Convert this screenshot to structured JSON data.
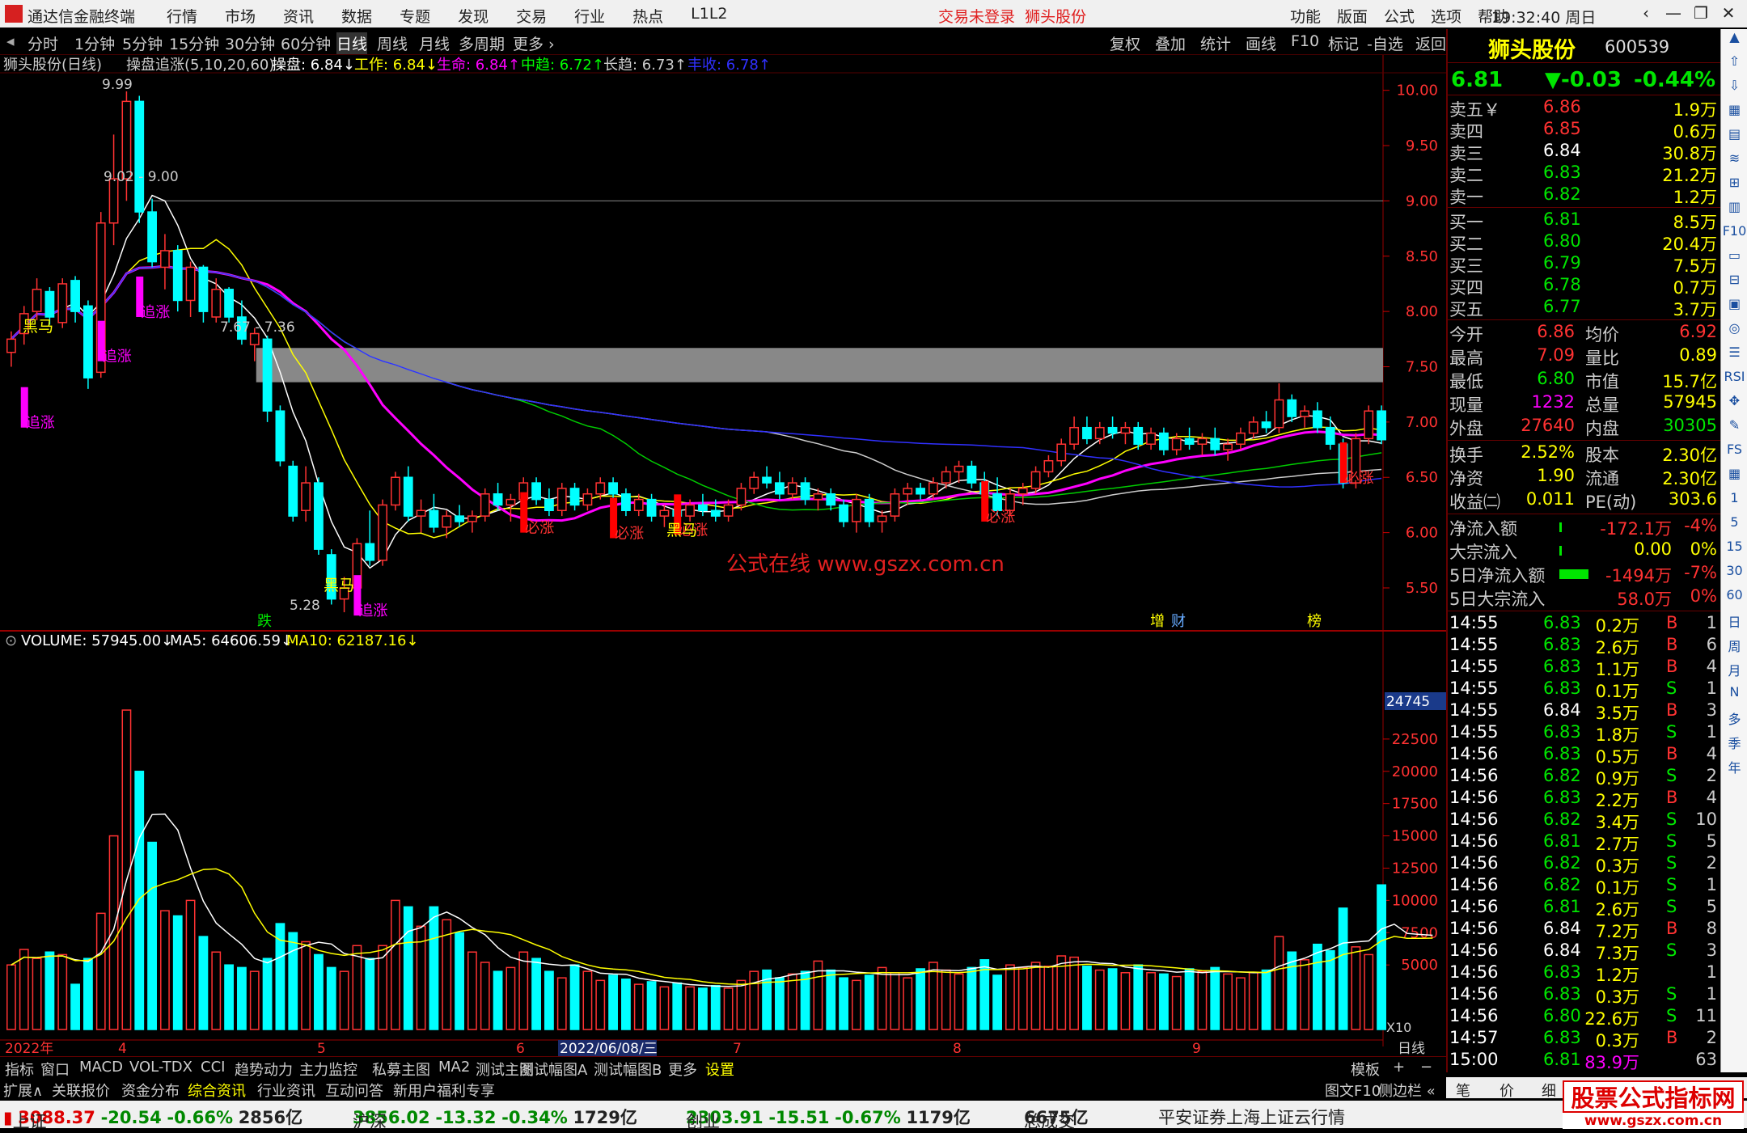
{
  "app": {
    "name": "通达信金融终端",
    "menu": [
      "行情",
      "市场",
      "资讯",
      "数据",
      "专题",
      "发现",
      "交易",
      "行业",
      "热点",
      "L1L2"
    ],
    "trade_status": "交易未登录",
    "stock_title": "狮头股份",
    "sysmenu": [
      "功能",
      "版面",
      "公式",
      "选项",
      "帮助"
    ],
    "time": "19:32:40",
    "weekday": "周日",
    "win_btns": [
      "‹",
      "—",
      "❐",
      "✕"
    ]
  },
  "periods": [
    "分时",
    "1分钟",
    "5分钟",
    "15分钟",
    "30分钟",
    "60分钟",
    "日线",
    "周线",
    "月线",
    "多周期",
    "更多 ›"
  ],
  "active_period": "日线",
  "ftools": [
    "复权",
    "叠加",
    "统计",
    "画线",
    "F10",
    "标记",
    "-自选",
    "返回"
  ],
  "main_chart": {
    "title": "狮头股份(日线)",
    "indicator": "操盘追涨(5,10,20,60)",
    "legend": [
      {
        "label": "操盘: 6.84",
        "arrow": "↓",
        "color": "#ffffff"
      },
      {
        "label": "工作: 6.84",
        "arrow": "↓",
        "color": "#ffff00"
      },
      {
        "label": "生命: 6.84",
        "arrow": "↑",
        "color": "#ff00ff"
      },
      {
        "label": "中趋: 6.72",
        "arrow": "↑",
        "color": "#00ff00"
      },
      {
        "label": "长趋: 6.73",
        "arrow": "↑",
        "color": "#cccccc"
      },
      {
        "label": "丰收: 6.78",
        "arrow": "↑",
        "color": "#3030ff"
      }
    ],
    "yaxis": [
      "10.00",
      "9.50",
      "9.00",
      "8.50",
      "8.00",
      "7.50",
      "7.00",
      "6.50",
      "6.00",
      "5.50"
    ],
    "annotations": {
      "high": "9.99",
      "range": "9.02 - 9.00",
      "band": "7.67 - 7.36",
      "low": "5.28",
      "heima": "黑马",
      "zhuizhang": "追涨",
      "bizhang": "必涨",
      "die": "跌",
      "zeng": "增",
      "cai": "财",
      "bang": "榜",
      "watermark": "公式在线  www.gszx.com.cn"
    }
  },
  "volume_chart": {
    "legend": [
      {
        "label": "VOLUME: 57945.00",
        "arrow": "↓",
        "color": "#ffffff"
      },
      {
        "label": "MA5: 64606.59",
        "arrow": "↓",
        "color": "#ffffff"
      },
      {
        "label": "MA10: 62187.16",
        "arrow": "↓",
        "color": "#ffff00"
      }
    ],
    "yaxis": [
      "22500",
      "20000",
      "17500",
      "15000",
      "12500",
      "10000",
      "7500",
      "5000"
    ],
    "ymax_label": "24745",
    "unit": "X10"
  },
  "time_axis": {
    "labels": [
      "2022年",
      "4",
      "5",
      "6",
      "2022/06/08/三",
      "7",
      "8",
      "9"
    ],
    "period": "日线"
  },
  "chart_data": {
    "type": "candlestick",
    "title": "狮头股份(日线)",
    "ylim": [
      5.2,
      10.1
    ],
    "ohlc": [
      [
        7.63,
        7.82,
        7.5,
        7.75
      ],
      [
        7.8,
        8.05,
        7.7,
        7.98
      ],
      [
        8.0,
        8.3,
        7.92,
        8.2
      ],
      [
        8.18,
        8.22,
        7.88,
        7.95
      ],
      [
        7.9,
        8.3,
        7.85,
        8.25
      ],
      [
        8.28,
        8.32,
        7.9,
        8.0
      ],
      [
        8.05,
        8.1,
        7.3,
        7.4
      ],
      [
        7.45,
        8.9,
        7.4,
        8.8
      ],
      [
        8.8,
        9.6,
        8.6,
        9.2
      ],
      [
        9.2,
        9.99,
        9.0,
        9.9
      ],
      [
        9.9,
        9.95,
        8.8,
        8.9
      ],
      [
        8.9,
        9.02,
        8.4,
        8.45
      ],
      [
        8.4,
        8.7,
        8.2,
        8.55
      ],
      [
        8.55,
        8.6,
        8.0,
        8.1
      ],
      [
        8.1,
        8.45,
        7.95,
        8.4
      ],
      [
        8.4,
        8.42,
        7.9,
        8.0
      ],
      [
        7.95,
        8.3,
        7.9,
        8.2
      ],
      [
        8.2,
        8.22,
        7.9,
        7.95
      ],
      [
        7.95,
        8.1,
        7.7,
        7.75
      ],
      [
        7.7,
        7.85,
        7.55,
        7.8
      ],
      [
        7.75,
        7.78,
        7.0,
        7.1
      ],
      [
        7.1,
        7.15,
        6.6,
        6.65
      ],
      [
        6.6,
        6.65,
        6.1,
        6.15
      ],
      [
        6.2,
        6.6,
        6.1,
        6.45
      ],
      [
        6.45,
        6.5,
        5.8,
        5.85
      ],
      [
        5.8,
        5.85,
        5.35,
        5.4
      ],
      [
        5.4,
        5.6,
        5.28,
        5.5
      ],
      [
        5.5,
        5.95,
        5.45,
        5.9
      ],
      [
        5.9,
        6.2,
        5.7,
        5.75
      ],
      [
        5.75,
        6.3,
        5.7,
        6.25
      ],
      [
        6.25,
        6.55,
        6.2,
        6.5
      ],
      [
        6.5,
        6.6,
        6.1,
        6.15
      ],
      [
        6.15,
        6.3,
        6.0,
        6.2
      ],
      [
        6.2,
        6.35,
        6.0,
        6.05
      ],
      [
        6.05,
        6.2,
        5.95,
        6.15
      ],
      [
        6.15,
        6.25,
        6.05,
        6.1
      ],
      [
        6.1,
        6.2,
        6.0,
        6.15
      ],
      [
        6.15,
        6.4,
        6.1,
        6.35
      ],
      [
        6.35,
        6.45,
        6.2,
        6.25
      ],
      [
        6.25,
        6.35,
        6.1,
        6.3
      ],
      [
        6.3,
        6.5,
        6.25,
        6.45
      ],
      [
        6.45,
        6.5,
        6.25,
        6.3
      ],
      [
        6.3,
        6.4,
        6.15,
        6.2
      ],
      [
        6.2,
        6.45,
        6.15,
        6.4
      ],
      [
        6.4,
        6.45,
        6.2,
        6.25
      ],
      [
        6.25,
        6.4,
        6.2,
        6.35
      ],
      [
        6.35,
        6.5,
        6.3,
        6.45
      ],
      [
        6.45,
        6.5,
        6.3,
        6.35
      ],
      [
        6.35,
        6.4,
        6.15,
        6.2
      ],
      [
        6.2,
        6.35,
        6.15,
        6.3
      ],
      [
        6.3,
        6.35,
        6.1,
        6.15
      ],
      [
        6.15,
        6.25,
        6.05,
        6.2
      ],
      [
        6.2,
        6.3,
        6.1,
        6.15
      ],
      [
        6.15,
        6.3,
        6.1,
        6.25
      ],
      [
        6.25,
        6.35,
        6.15,
        6.2
      ],
      [
        6.2,
        6.3,
        6.1,
        6.15
      ],
      [
        6.15,
        6.3,
        6.1,
        6.25
      ],
      [
        6.25,
        6.45,
        6.2,
        6.4
      ],
      [
        6.4,
        6.55,
        6.35,
        6.5
      ],
      [
        6.5,
        6.6,
        6.4,
        6.45
      ],
      [
        6.45,
        6.55,
        6.3,
        6.35
      ],
      [
        6.35,
        6.5,
        6.3,
        6.45
      ],
      [
        6.45,
        6.5,
        6.25,
        6.3
      ],
      [
        6.3,
        6.4,
        6.2,
        6.35
      ],
      [
        6.35,
        6.4,
        6.2,
        6.25
      ],
      [
        6.25,
        6.3,
        6.05,
        6.1
      ],
      [
        6.1,
        6.35,
        6.0,
        6.3
      ],
      [
        6.3,
        6.35,
        6.05,
        6.1
      ],
      [
        6.1,
        6.2,
        6.0,
        6.15
      ],
      [
        6.15,
        6.4,
        6.1,
        6.35
      ],
      [
        6.35,
        6.45,
        6.25,
        6.4
      ],
      [
        6.4,
        6.45,
        6.3,
        6.35
      ],
      [
        6.35,
        6.5,
        6.3,
        6.45
      ],
      [
        6.45,
        6.6,
        6.4,
        6.55
      ],
      [
        6.55,
        6.65,
        6.45,
        6.6
      ],
      [
        6.6,
        6.65,
        6.4,
        6.45
      ],
      [
        6.45,
        6.55,
        6.3,
        6.35
      ],
      [
        6.35,
        6.5,
        6.15,
        6.2
      ],
      [
        6.2,
        6.4,
        6.15,
        6.35
      ],
      [
        6.35,
        6.45,
        6.25,
        6.4
      ],
      [
        6.4,
        6.6,
        6.35,
        6.55
      ],
      [
        6.55,
        6.7,
        6.5,
        6.65
      ],
      [
        6.65,
        6.85,
        6.6,
        6.8
      ],
      [
        6.8,
        7.05,
        6.75,
        6.95
      ],
      [
        6.95,
        7.05,
        6.8,
        6.85
      ],
      [
        6.85,
        7.0,
        6.8,
        6.95
      ],
      [
        6.95,
        7.05,
        6.85,
        6.9
      ],
      [
        6.9,
        7.0,
        6.8,
        6.95
      ],
      [
        6.95,
        7.0,
        6.75,
        6.8
      ],
      [
        6.8,
        6.95,
        6.75,
        6.9
      ],
      [
        6.9,
        6.95,
        6.7,
        6.75
      ],
      [
        6.75,
        6.9,
        6.7,
        6.85
      ],
      [
        6.85,
        6.95,
        6.75,
        6.8
      ],
      [
        6.8,
        6.9,
        6.7,
        6.85
      ],
      [
        6.85,
        6.95,
        6.7,
        6.75
      ],
      [
        6.75,
        6.85,
        6.65,
        6.8
      ],
      [
        6.8,
        6.95,
        6.75,
        6.9
      ],
      [
        6.9,
        7.05,
        6.85,
        7.0
      ],
      [
        7.0,
        7.1,
        6.9,
        6.95
      ],
      [
        6.95,
        7.35,
        6.9,
        7.2
      ],
      [
        7.2,
        7.25,
        7.0,
        7.05
      ],
      [
        7.05,
        7.15,
        6.95,
        7.1
      ],
      [
        7.1,
        7.18,
        6.9,
        6.95
      ],
      [
        6.95,
        7.05,
        6.75,
        6.8
      ],
      [
        6.8,
        6.85,
        6.4,
        6.45
      ],
      [
        6.45,
        6.9,
        6.4,
        6.85
      ],
      [
        6.85,
        7.15,
        6.8,
        7.1
      ],
      [
        7.1,
        7.15,
        6.8,
        6.84
      ]
    ],
    "volume_x10": [
      5000,
      6200,
      5500,
      6000,
      5800,
      3500,
      5500,
      9000,
      15000,
      24745,
      20000,
      14500,
      9200,
      8800,
      10000,
      7200,
      6000,
      5000,
      4800,
      4500,
      5500,
      8200,
      7500,
      6800,
      5800,
      4800,
      4500,
      6500,
      5500,
      6500,
      10000,
      9500,
      8000,
      9500,
      8500,
      7500,
      6000,
      5200,
      4500,
      4800,
      6000,
      5500,
      4500,
      4000,
      5000,
      4500,
      3800,
      4200,
      3900,
      3500,
      3700,
      3300,
      3600,
      3300,
      3200,
      3400,
      3200,
      3800,
      4500,
      4600,
      4000,
      4300,
      4500,
      5300,
      4600,
      4000,
      3800,
      4200,
      4800,
      4400,
      4000,
      4700,
      5200,
      4600,
      4300,
      4800,
      5400,
      4200,
      5000,
      4800,
      5200,
      4900,
      5700,
      5600,
      4900,
      4600,
      4700,
      4400,
      5000,
      4400,
      4300,
      4100,
      4700,
      4500,
      4800,
      4300,
      4000,
      4400,
      4600,
      7200,
      6000,
      5400,
      6600,
      6100,
      9400,
      6400,
      5800,
      11200,
      8000,
      5800,
      6000,
      5500
    ]
  },
  "quote": {
    "name": "狮头股份",
    "code": "600539",
    "price": "6.81",
    "change": "▼-0.03",
    "change_pct": "-0.44%",
    "asks": [
      {
        "label": "卖五￥",
        "price": "6.86",
        "vol": "1.9万",
        "pc": "up"
      },
      {
        "label": "卖四",
        "price": "6.85",
        "vol": "0.6万",
        "pc": "up"
      },
      {
        "label": "卖三",
        "price": "6.84",
        "vol": "30.8万",
        "pc": "wh"
      },
      {
        "label": "卖二",
        "price": "6.83",
        "vol": "21.2万",
        "pc": "dn"
      },
      {
        "label": "卖一",
        "price": "6.82",
        "vol": "1.2万",
        "pc": "dn"
      }
    ],
    "bids": [
      {
        "label": "买一",
        "price": "6.81",
        "vol": "8.5万",
        "pc": "dn"
      },
      {
        "label": "买二",
        "price": "6.80",
        "vol": "20.4万",
        "pc": "dn"
      },
      {
        "label": "买三",
        "price": "6.79",
        "vol": "7.5万",
        "pc": "dn"
      },
      {
        "label": "买四",
        "price": "6.78",
        "vol": "0.7万",
        "pc": "dn"
      },
      {
        "label": "买五",
        "price": "6.77",
        "vol": "3.7万",
        "pc": "dn"
      }
    ],
    "stats": [
      {
        "a": "今开",
        "av": "6.86",
        "ac": "up",
        "b": "均价",
        "bv": "6.92",
        "bc": "up"
      },
      {
        "a": "最高",
        "av": "7.09",
        "ac": "up",
        "b": "量比",
        "bv": "0.89",
        "bc": "yl"
      },
      {
        "a": "最低",
        "av": "6.80",
        "ac": "dn",
        "b": "市值",
        "bv": "15.7亿",
        "bc": "yl"
      },
      {
        "a": "现量",
        "av": "1232",
        "ac": "mg",
        "b": "总量",
        "bv": "57945",
        "bc": "yl"
      },
      {
        "a": "外盘",
        "av": "27640",
        "ac": "up",
        "b": "内盘",
        "bv": "30305",
        "bc": "dn"
      }
    ],
    "stats2": [
      {
        "a": "换手",
        "av": "2.52%",
        "ac": "yl",
        "b": "股本",
        "bv": "2.30亿",
        "bc": "yl"
      },
      {
        "a": "净资",
        "av": "1.90",
        "ac": "yl",
        "b": "流通",
        "bv": "2.30亿",
        "bc": "yl"
      },
      {
        "a": "收益㈡",
        "av": "0.011",
        "ac": "yl",
        "b": "PE(动)",
        "bv": "303.6",
        "bc": "yl"
      }
    ],
    "flows": [
      {
        "label": "净流入额",
        "value": "-172.1万",
        "pct": "-4%",
        "c": "up",
        "bar": "small"
      },
      {
        "label": "大宗流入",
        "value": "0.00",
        "pct": "0%",
        "c": "yl",
        "bar": "tiny"
      },
      {
        "label": "5日净流入额",
        "value": "-1494万",
        "pct": "-7%",
        "c": "up",
        "bar": "big"
      },
      {
        "label": "5日大宗流入",
        "value": "58.0万",
        "pct": "0%",
        "c": "up",
        "bar": "none"
      }
    ],
    "ticks": [
      [
        "14:55",
        "6.83",
        "0.2万",
        "B",
        "1"
      ],
      [
        "14:55",
        "6.83",
        "2.6万",
        "B",
        "6"
      ],
      [
        "14:55",
        "6.83",
        "1.1万",
        "B",
        "4"
      ],
      [
        "14:55",
        "6.83",
        "0.1万",
        "S",
        "1"
      ],
      [
        "14:55",
        "6.84",
        "3.5万",
        "B",
        "3"
      ],
      [
        "14:55",
        "6.83",
        "1.8万",
        "S",
        "1"
      ],
      [
        "14:56",
        "6.83",
        "0.5万",
        "B",
        "4"
      ],
      [
        "14:56",
        "6.82",
        "0.9万",
        "S",
        "2"
      ],
      [
        "14:56",
        "6.83",
        "2.2万",
        "B",
        "4"
      ],
      [
        "14:56",
        "6.82",
        "3.4万",
        "S",
        "10"
      ],
      [
        "14:56",
        "6.81",
        "2.7万",
        "S",
        "5"
      ],
      [
        "14:56",
        "6.82",
        "0.3万",
        "S",
        "2"
      ],
      [
        "14:56",
        "6.82",
        "0.1万",
        "S",
        "1"
      ],
      [
        "14:56",
        "6.81",
        "2.6万",
        "S",
        "5"
      ],
      [
        "14:56",
        "6.84",
        "7.2万",
        "B",
        "8"
      ],
      [
        "14:56",
        "6.84",
        "7.3万",
        "S",
        "3"
      ],
      [
        "14:56",
        "6.83",
        "1.2万",
        "",
        "1"
      ],
      [
        "14:56",
        "6.83",
        "0.3万",
        "S",
        "1"
      ],
      [
        "14:56",
        "6.80",
        "22.6万",
        "S",
        "11"
      ],
      [
        "14:57",
        "6.83",
        "0.3万",
        "B",
        "2"
      ],
      [
        "15:00",
        "6.81",
        "83.9万",
        "",
        "63"
      ]
    ]
  },
  "vtools": [
    "▲",
    "⇧",
    "⇩",
    "▦",
    "▤",
    "≋",
    "⊞",
    "▥",
    "F10",
    "▭",
    "⊟",
    "▣",
    "◎",
    "☰",
    "RSI",
    "✥",
    "✎",
    "FS",
    "▦",
    "1",
    "5",
    "15",
    "30",
    "60",
    "日",
    "周",
    "月",
    "N",
    "多",
    "季",
    "年"
  ],
  "tabs1": [
    "指标",
    "窗口",
    "MACD",
    "VOL-TDX",
    "CCI",
    "趋势动力",
    "主力监控",
    "私募主图",
    "MA2",
    "测试主图",
    "测试幅图A",
    "测试幅图B",
    "更多",
    "设置",
    "模板",
    "+",
    "−"
  ],
  "tabs2": [
    "扩展∧",
    "关联报价",
    "资金分布",
    "综合资讯",
    "行业资讯",
    "互动问答",
    "新用户福利专享",
    "图文F10",
    "侧边栏 «"
  ],
  "rbottom": [
    "笔",
    "价",
    "细",
    "势"
  ],
  "status": {
    "sh_label": "上证",
    "sh": "3088.37",
    "sh_ch": "-20.54",
    "sh_pct": "-0.66%",
    "sh_amt": "2856亿",
    "hs_label": "沪深",
    "hs": "3856.02",
    "hs_ch": "-13.32",
    "hs_pct": "-0.34%",
    "hs_amt": "1729亿",
    "cy_label": "创业",
    "cy": "2303.91",
    "cy_ch": "-15.51",
    "cy_pct": "-0.67%",
    "cy_amt": "1179亿",
    "tot_label": "总成交",
    "tot": "6675亿",
    "broker": "平安证券上海上证云行情"
  },
  "site_watermark": {
    "title": "股票公式指标网",
    "url": "www.gszx.com.cn"
  }
}
